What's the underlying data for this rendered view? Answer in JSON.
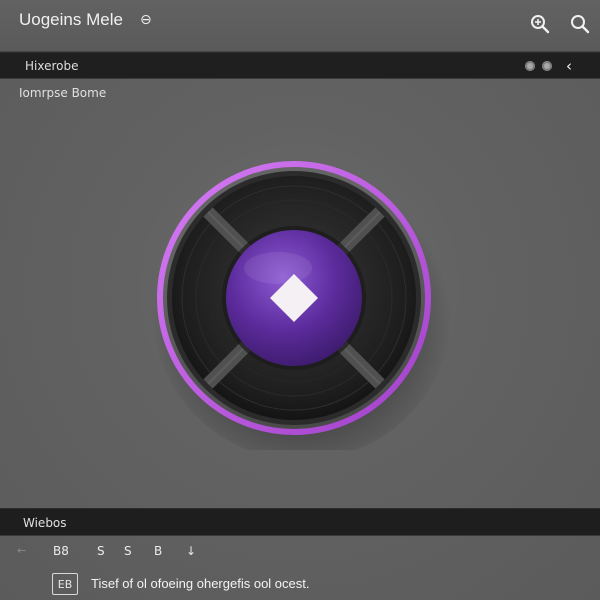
{
  "window": {
    "title": "Uogeins Mele",
    "title_badge": "⊖"
  },
  "toolbar": {
    "label": "Hixerobe",
    "back_glyph": "‹"
  },
  "content": {
    "heading": "Iomrpse Bome"
  },
  "bottom_bar": {
    "label": "Wiebos"
  },
  "format_bar": {
    "side_label": "←",
    "items": [
      "B8",
      "S",
      "S",
      "B",
      "↓"
    ]
  },
  "status": {
    "doc_label": "EB",
    "text": "Tisef of ol ofoeing ohergefis ool ocest."
  },
  "colors": {
    "accent": "#b44fd6",
    "accent_glow": "#cf74ef",
    "center_purple": "#5a2a9a",
    "ring_dark": "#1b1b1b",
    "bar_dark": "#1f1f1f"
  },
  "icons": {
    "search_1": "search-plus-icon",
    "search_2": "search-icon",
    "disc_center": "diamond-icon"
  }
}
